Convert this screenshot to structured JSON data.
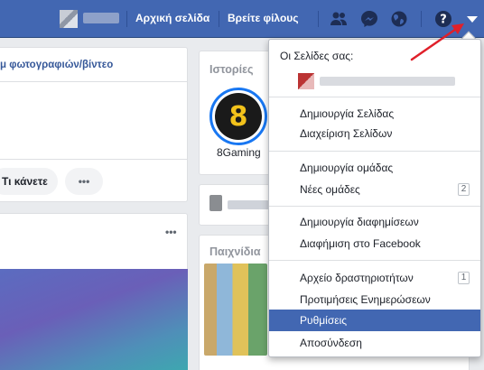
{
  "topbar": {
    "home_label": "Αρχική σελίδα",
    "find_friends_label": "Βρείτε φίλους",
    "icons": [
      "friends-icon",
      "messenger-icon",
      "globe-icon",
      "help-icon",
      "menu-arrow-icon"
    ],
    "bg_color": "#4267b2"
  },
  "feed": {
    "post_header_label": "μ φωτογραφιών/βίντεο",
    "action_label": "Τι κάνετε",
    "more_label": "•••",
    "card_menu_label": "•••"
  },
  "right_col": {
    "stories_title": "Ιστορίες",
    "story_name": "8Gaming",
    "story_logo": "8",
    "games_title": "Παιχνίδια"
  },
  "dropdown": {
    "pages_header": "Οι Σελίδες σας:",
    "groups": [
      [
        {
          "label": "Δημιουργία Σελίδας"
        },
        {
          "label": "Διαχείριση Σελίδων"
        }
      ],
      [
        {
          "label": "Δημιουργία ομάδας"
        },
        {
          "label": "Νέες ομάδες",
          "badge": "2"
        }
      ],
      [
        {
          "label": "Δημιουργία διαφημίσεων"
        },
        {
          "label": "Διαφήμιση στο Facebook"
        }
      ],
      [
        {
          "label": "Αρχείο δραστηριοτήτων",
          "badge": "1"
        },
        {
          "label": "Προτιμήσεις Ενημερώσεων"
        },
        {
          "label": "Ρυθμίσεις",
          "active": true
        },
        {
          "label": "Αποσύνδεση"
        }
      ]
    ],
    "active_color": "#4267b2"
  },
  "annotation": {
    "arrow_color": "#e0202a"
  }
}
